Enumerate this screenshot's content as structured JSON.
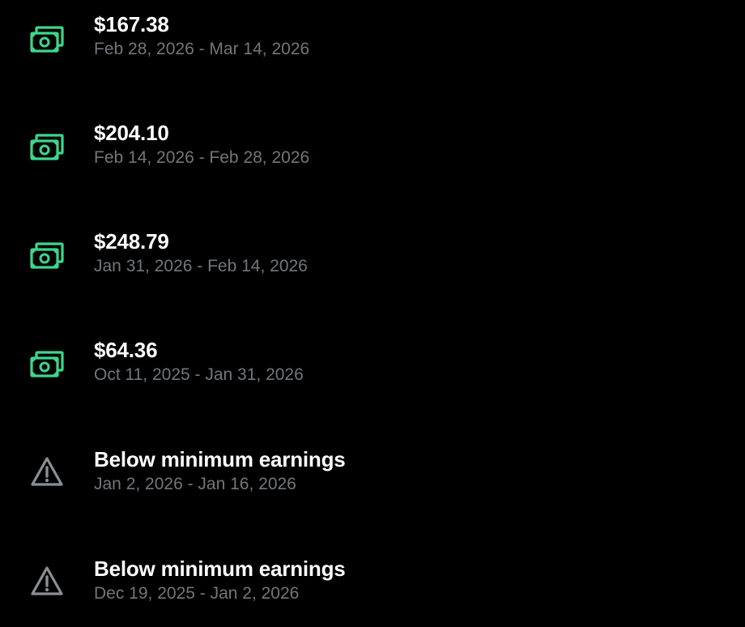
{
  "accent_color": "#3dd68c",
  "warning_color": "#8b8f94",
  "payouts": [
    {
      "icon": "money-icon",
      "title": "$167.38",
      "period": "Feb 28, 2026 - Mar 14, 2026"
    },
    {
      "icon": "money-icon",
      "title": "$204.10",
      "period": "Feb 14, 2026 - Feb 28, 2026"
    },
    {
      "icon": "money-icon",
      "title": "$248.79",
      "period": "Jan 31, 2026 - Feb 14, 2026"
    },
    {
      "icon": "money-icon",
      "title": "$64.36",
      "period": "Oct 11, 2025 - Jan 31, 2026"
    },
    {
      "icon": "warning-icon",
      "title": "Below minimum earnings",
      "period": "Jan 2, 2026 - Jan 16, 2026"
    },
    {
      "icon": "warning-icon",
      "title": "Below minimum earnings",
      "period": "Dec 19, 2025 - Jan 2, 2026"
    }
  ]
}
